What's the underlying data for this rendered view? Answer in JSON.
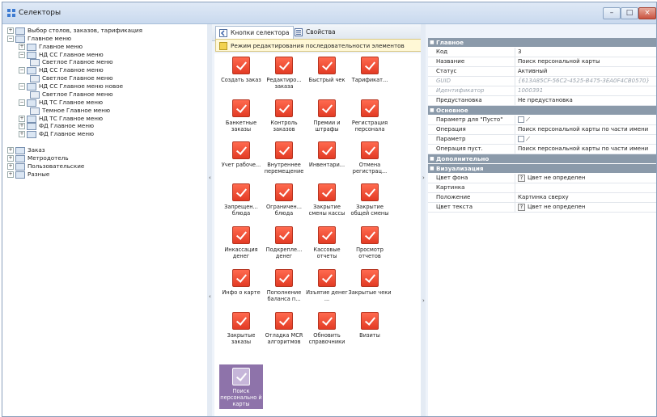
{
  "window": {
    "title": "Селекторы",
    "controls": [
      "–",
      "□",
      "×"
    ]
  },
  "tree": [
    {
      "label": "Выбор столов, заказов, тарификация",
      "level": 0,
      "toggle": "+",
      "icon": "folder-icon"
    },
    {
      "label": "Главное меню",
      "level": 0,
      "toggle": "−",
      "icon": "folder-icon"
    },
    {
      "label": "Главное меню",
      "level": 1,
      "toggle": "+",
      "icon": "selector-icon"
    },
    {
      "label": "НД СС Главное меню",
      "level": 1,
      "toggle": "−",
      "icon": "selector-icon"
    },
    {
      "label": "Светлое Главное меню",
      "level": 2,
      "toggle": "",
      "icon": "color-scheme-icon"
    },
    {
      "label": "НД СС Главное меню",
      "level": 1,
      "toggle": "−",
      "icon": "selector-icon"
    },
    {
      "label": "Светлое Главное меню",
      "level": 2,
      "toggle": "",
      "icon": "color-scheme-icon"
    },
    {
      "label": "НД СС Главное меню новое",
      "level": 1,
      "toggle": "−",
      "icon": "selector-icon"
    },
    {
      "label": "Светлое Главное меню",
      "level": 2,
      "toggle": "",
      "icon": "color-scheme-icon"
    },
    {
      "label": "НД ТС Главное меню",
      "level": 1,
      "toggle": "−",
      "icon": "selector-icon"
    },
    {
      "label": "Темное Главное меню",
      "level": 2,
      "toggle": "",
      "icon": "color-scheme-icon"
    },
    {
      "label": "НД ТС Главное меню",
      "level": 1,
      "toggle": "+",
      "icon": "selector-icon"
    },
    {
      "label": "ФД Главное меню",
      "level": 1,
      "toggle": "+",
      "icon": "selector-icon"
    },
    {
      "label": "ФД Главное меню",
      "level": 1,
      "toggle": "+",
      "icon": "selector-icon"
    },
    {
      "label": "Заказ",
      "level": 0,
      "toggle": "+",
      "icon": "folder-icon"
    },
    {
      "label": "Метродотель",
      "level": 0,
      "toggle": "+",
      "icon": "folder-icon"
    },
    {
      "label": "Пользовательские",
      "level": 0,
      "toggle": "+",
      "icon": "folder-icon"
    },
    {
      "label": "Разные",
      "level": 0,
      "toggle": "+",
      "icon": "folder-icon"
    }
  ],
  "tabs": [
    {
      "label": "Кнопки селектора",
      "icon": "buttons-icon",
      "active": true
    },
    {
      "label": "Свойства",
      "icon": "properties-icon",
      "active": false
    }
  ],
  "banner": {
    "text": "Режим редактирования последовательности элементов",
    "icon": "edit-mode-icon"
  },
  "buttons": [
    [
      "Создать заказ",
      "Редактиро... заказа",
      "Быстрый чек",
      "Тарификат..."
    ],
    [
      "Банкетные заказы",
      "Контроль заказов",
      "Премии и штрафы",
      "Регистрация персонала"
    ],
    [
      "Учет рабоче...",
      "Внутреннее перемещение",
      "Инвентари...",
      "Отмена регистрац..."
    ],
    [
      "Запрещен... блюда",
      "Ограничен... блюда",
      "Закрытие смены кассы",
      "Закрытие общей смены"
    ],
    [
      "Инкассация денег",
      "Подкрепле... денег",
      "Кассовые отчеты",
      "Просмотр отчетов"
    ],
    [
      "Инфо о карте",
      "Пополнение баланса п...",
      "Изъятие денег ...",
      "Закрытые чеки"
    ],
    [
      "Закрытые заказы",
      "Отладка MCR алгоритмов",
      "Обновить справочники",
      "Визиты"
    ],
    [
      "Поиск персонально й карты"
    ]
  ],
  "properties": [
    {
      "category": "Главное",
      "rows": [
        {
          "key": "Код",
          "value": "3"
        },
        {
          "key": "Название",
          "value": "Поиск персональной карты"
        },
        {
          "key": "Статус",
          "value": "Активный"
        },
        {
          "key": "GUID",
          "value": "{613A85CF-56C2-4525-B475-3EA0F4CB0570}",
          "muted": true
        },
        {
          "key": "Идентификатор",
          "value": "1000391",
          "muted": true
        },
        {
          "key": "Предустановка",
          "value": "Не предустановка"
        }
      ]
    },
    {
      "category": "Основное",
      "rows": [
        {
          "key": "Параметр для \"Пусто\"",
          "value": "",
          "checkbox": true
        },
        {
          "key": "Операция",
          "value": "Поиск персональной карты по части имени"
        },
        {
          "key": "Параметр",
          "value": "",
          "checkbox": true
        },
        {
          "key": "Операция пуст.",
          "value": "Поиск персональной карты по части имени"
        }
      ]
    },
    {
      "category": "Дополнительно",
      "rows": []
    },
    {
      "category": "Визуализация",
      "rows": [
        {
          "key": "Цвет фона",
          "value": "Цвет не определен",
          "question": true
        },
        {
          "key": "Картинка",
          "value": ""
        },
        {
          "key": "Положение",
          "value": "Картинка сверху"
        },
        {
          "key": "Цвет текста",
          "value": "Цвет не определен",
          "question": true
        }
      ]
    }
  ],
  "colors": {
    "button_red": "#e8412a",
    "selected_purple": "#8e73aa",
    "category_header": "#8b9aaa",
    "banner_bg": "#fff8d6"
  }
}
